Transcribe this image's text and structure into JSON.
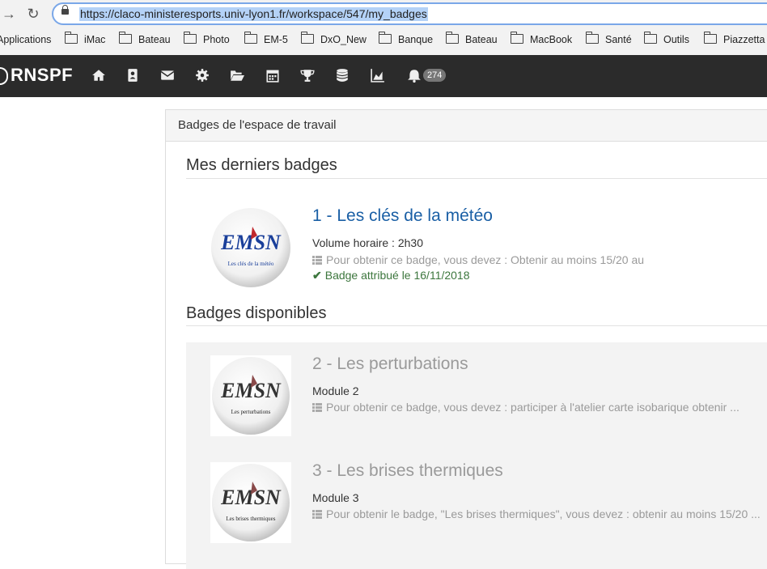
{
  "browser": {
    "url": "https://claco-ministeresports.univ-lyon1.fr/workspace/547/my_badges",
    "bookmarks": [
      "Applications",
      "iMac",
      "Bateau",
      "Photo",
      "EM-5",
      "DxO_New",
      "Banque",
      "Bateau",
      "MacBook",
      "Santé",
      "Outils",
      "Piazzetta"
    ]
  },
  "appbar": {
    "brand": "RNSPF",
    "nav_icons": [
      "home-icon",
      "contact-card-icon",
      "envelope-icon",
      "gear-icon",
      "folder-open-icon",
      "calendar-icon",
      "trophy-icon",
      "database-icon",
      "area-chart-icon",
      "bell-icon"
    ],
    "notifications": "274"
  },
  "panel": {
    "title": "Badges de l'espace de travail",
    "recent": {
      "heading": "Mes derniers badges",
      "badges": [
        {
          "title": "1 - Les clés de la météo",
          "logo": "EMSN",
          "image_caption": "Les clés de la météo",
          "info": "Volume horaire : 2h30",
          "criteria": "Pour obtenir ce badge, vous devez : Obtenir au moins 15/20 au",
          "awarded": "Badge attribué le 16/11/2018"
        }
      ]
    },
    "available": {
      "heading": "Badges disponibles",
      "badges": [
        {
          "title": "2 - Les perturbations",
          "logo": "EMSN",
          "image_caption": "Les perturbations",
          "info": "Module 2",
          "criteria": "Pour obtenir ce badge, vous devez : participer à l'atelier carte isobarique obtenir ..."
        },
        {
          "title": "3 - Les brises thermiques",
          "logo": "EMSN",
          "image_caption": "Les brises thermiques",
          "info": "Module 3",
          "criteria": "Pour obtenir le badge, \"Les brises thermiques\", vous devez : obtenir au moins 15/20 ..."
        }
      ]
    }
  },
  "colors": {
    "appbar_bg": "#2b2b2b",
    "link_blue": "#1a5fa5",
    "muted_gray": "#9a9a9a",
    "success_green": "#3c763d",
    "url_selection": "#b4d2f7"
  }
}
